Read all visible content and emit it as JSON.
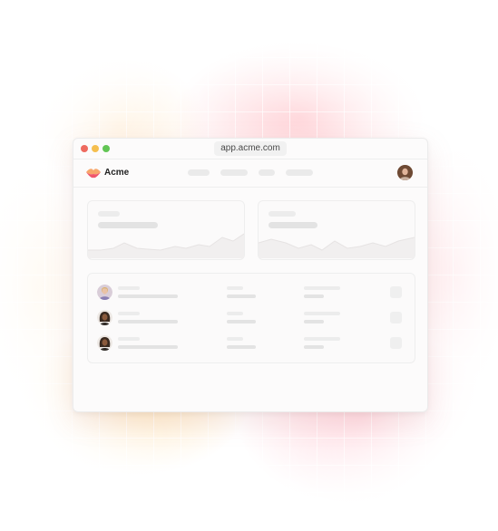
{
  "browser": {
    "url": "app.acme.com"
  },
  "app": {
    "brand_name": "Acme",
    "accent_color": "#f59a6a"
  },
  "header": {
    "nav_items": [
      "",
      "",
      "",
      ""
    ],
    "user_avatar": "user-avatar"
  },
  "dashboard": {
    "cards": [
      {
        "title": "",
        "value": "",
        "chart": "sparkline"
      },
      {
        "title": "",
        "value": "",
        "chart": "sparkline"
      }
    ],
    "table_rows": [
      {
        "avatar": "person-avatar-1"
      },
      {
        "avatar": "person-avatar-2"
      },
      {
        "avatar": "person-avatar-3"
      }
    ]
  }
}
